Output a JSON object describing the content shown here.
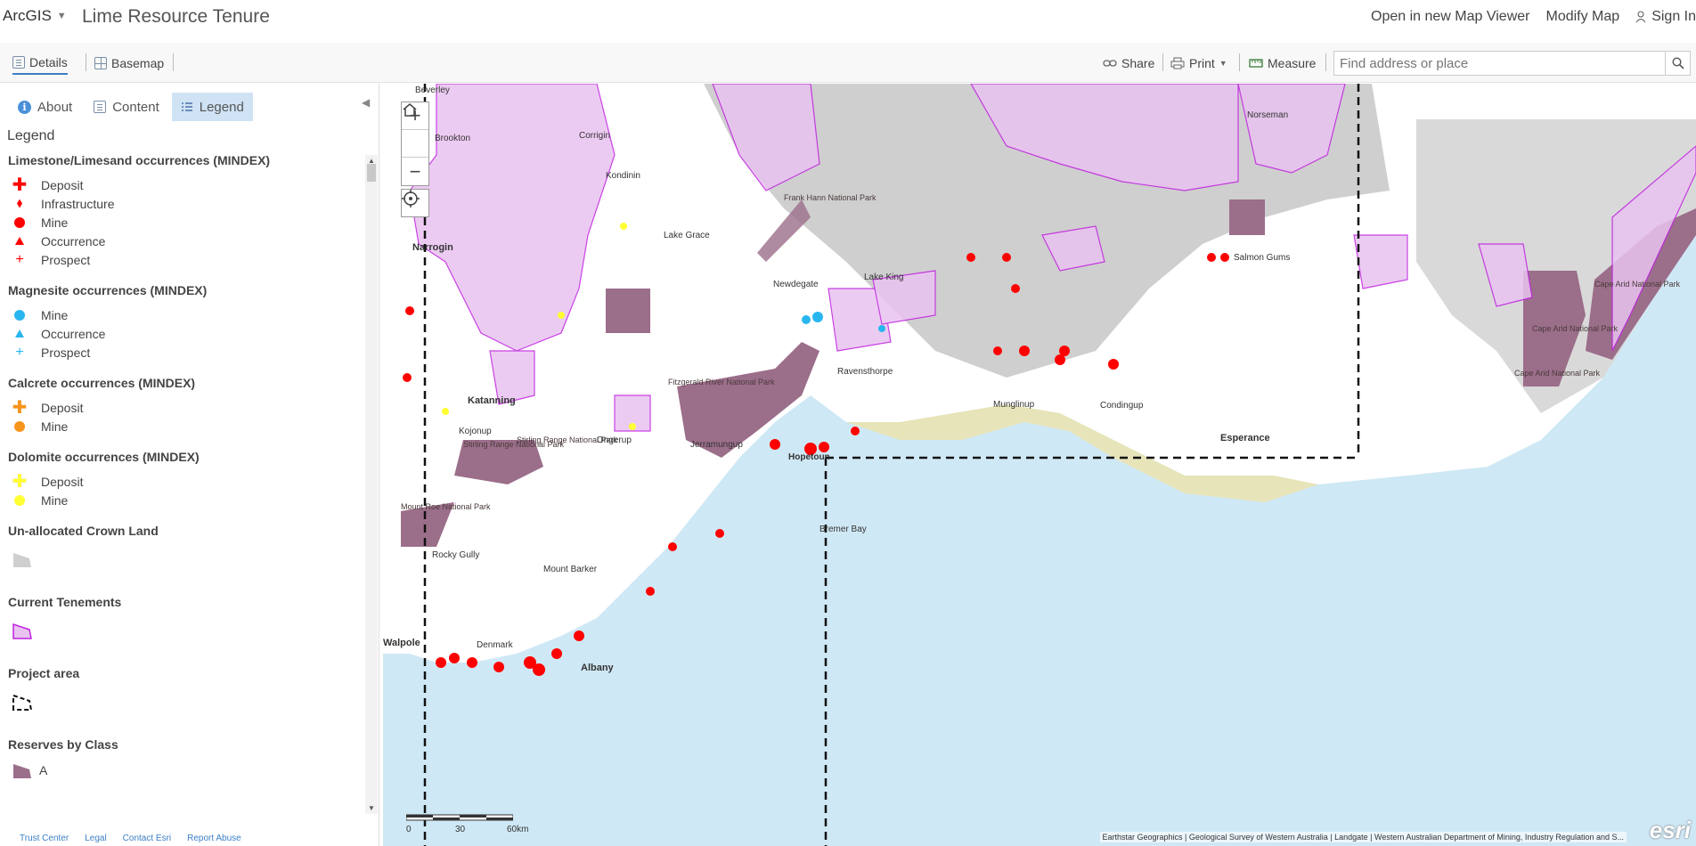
{
  "header": {
    "brand": "ArcGIS",
    "title": "Lime Resource Tenure",
    "actions": {
      "open_new": "Open in new Map Viewer",
      "modify": "Modify Map",
      "sign_in": "Sign In"
    }
  },
  "toolbar": {
    "details": "Details",
    "basemap": "Basemap",
    "share": "Share",
    "print": "Print",
    "measure": "Measure",
    "search_placeholder": "Find address or place"
  },
  "panel": {
    "tabs": {
      "about": "About",
      "content": "Content",
      "legend": "Legend"
    },
    "heading": "Legend"
  },
  "legend": {
    "limestone": {
      "title": "Limestone/Limesand occurrences (MINDEX)",
      "items": [
        "Deposit",
        "Infrastructure",
        "Mine",
        "Occurrence",
        "Prospect"
      ]
    },
    "magnesite": {
      "title": "Magnesite occurrences (MINDEX)",
      "items": [
        "Mine",
        "Occurrence",
        "Prospect"
      ]
    },
    "calcrete": {
      "title": "Calcrete occurrences (MINDEX)",
      "items": [
        "Deposit",
        "Mine"
      ]
    },
    "dolomite": {
      "title": "Dolomite occurrences (MINDEX)",
      "items": [
        "Deposit",
        "Mine"
      ]
    },
    "crown_land": {
      "title": "Un-allocated Crown Land"
    },
    "tenements": {
      "title": "Current Tenements"
    },
    "project_area": {
      "title": "Project area"
    },
    "reserves": {
      "title": "Reserves by Class",
      "items": [
        "A"
      ]
    }
  },
  "footer": {
    "links": [
      "Trust Center",
      "Legal",
      "Contact Esri",
      "Report Abuse"
    ]
  },
  "map": {
    "towns": [
      "Beverley",
      "Brookton",
      "Corrigin",
      "Kondinin",
      "Narrogin",
      "Lake Grace",
      "Newdegate",
      "Lake King",
      "Katanning",
      "Kojonup",
      "Ongerup",
      "Jerramungup",
      "Hopetoun",
      "Ravensthorpe",
      "Esperance",
      "Salmon Gums",
      "Norseman",
      "Rocky Gully",
      "Mount Barker",
      "Denmark",
      "Albany",
      "Walpole",
      "Bremer Bay",
      "Munglinup",
      "Condingup"
    ],
    "parks": [
      "Frank Hann National Park",
      "Fitzgerald River National Park",
      "Stirling Range National Park",
      "Stirling Range National Park",
      "Mount Roe National Park",
      "Cape Arid National Park",
      "Cape Arid National Park",
      "Cape Arid National Park"
    ],
    "scale": {
      "labels": [
        "0",
        "30",
        "60km"
      ]
    },
    "attribution": "Earthstar Geographics | Geological Survey of Western Australia | Landgate | Western Australian Department of Mining, Industry Regulation and S...",
    "logo": "esri",
    "colors": {
      "ocean": "#cfe8f5",
      "land": "#ffffff",
      "tenement_fill": "#e9c3f0",
      "tenement_stroke": "#c020e0",
      "reserve": "#9b6e8a",
      "crown_land": "#cfcfcf",
      "red_symbol": "#ff0000",
      "cyan_symbol": "#29b6ef",
      "yellow_symbol": "#ffff33",
      "orange_symbol": "#f7941d"
    }
  }
}
